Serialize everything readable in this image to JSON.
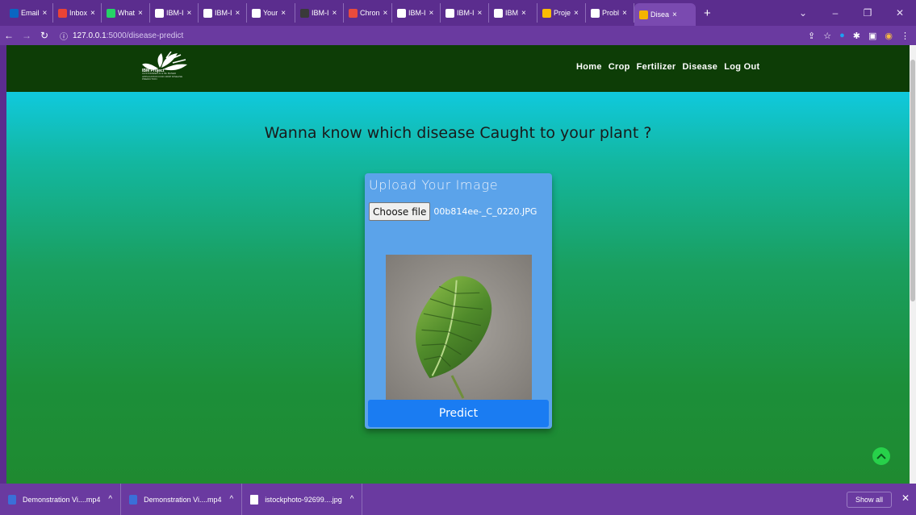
{
  "browser": {
    "tabs": [
      {
        "label": "Email",
        "favicon_color": "#0a66c2"
      },
      {
        "label": "Inbox",
        "favicon_color": "#ea4335"
      },
      {
        "label": "What",
        "favicon_color": "#25d366"
      },
      {
        "label": "IBM-I",
        "favicon_color": "#ffffff"
      },
      {
        "label": "IBM-I",
        "favicon_color": "#ffffff"
      },
      {
        "label": "Your",
        "favicon_color": "#ffffff"
      },
      {
        "label": "IBM-I",
        "favicon_color": "#3a3a3a"
      },
      {
        "label": "Chron",
        "favicon_color": "#e94b3c"
      },
      {
        "label": "IBM-I",
        "favicon_color": "#ffffff"
      },
      {
        "label": "IBM-I",
        "favicon_color": "#ffffff"
      },
      {
        "label": "IBM",
        "favicon_color": "#ffffff"
      },
      {
        "label": "Proje",
        "favicon_color": "#fbbc04"
      },
      {
        "label": "Probl",
        "favicon_color": "#ffffff"
      },
      {
        "label": "Disea",
        "favicon_color": "#f4b400",
        "active": true
      }
    ],
    "url_host": "127.0.0.1",
    "url_path": ":5000/disease-predict"
  },
  "site": {
    "logo_caption": "IBM Project",
    "logo_subcaption": "CUSTOMIZED AI & ML BASED APPLICATION FOR CROP DISEASE PREDICTION",
    "nav": [
      "Home",
      "Crop",
      "Fertilizer",
      "Disease",
      "Log Out"
    ],
    "heading": "Wanna know which disease Caught to your plant ?",
    "upload": {
      "title": "Upload Your Image",
      "button": "Choose file",
      "filename": "00b814ee-_C_0220.JPG"
    },
    "predict_label": "Predict"
  },
  "downloads": {
    "items": [
      "Demonstration Vi....mp4",
      "Demonstration Vi....mp4",
      "istockphoto-92699....jpg"
    ],
    "show_all": "Show all"
  }
}
